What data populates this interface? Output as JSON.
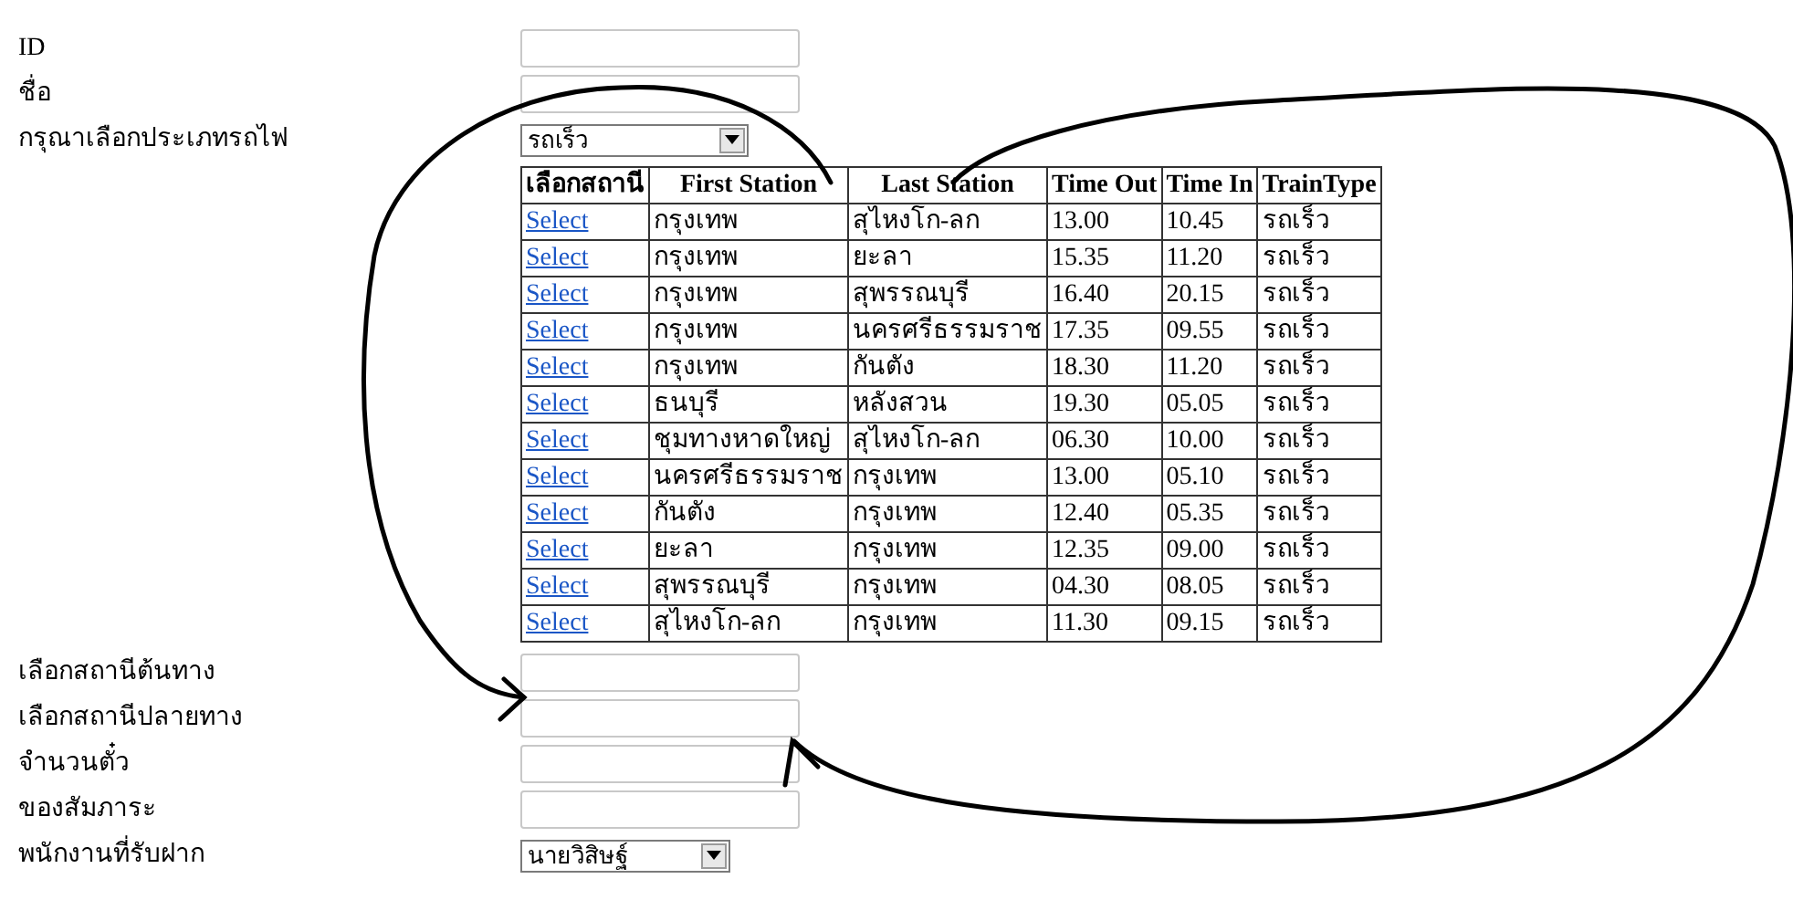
{
  "top_fields": [
    {
      "kind": "text",
      "label": "ID"
    },
    {
      "kind": "text",
      "label": "ชื่อ"
    },
    {
      "kind": "select",
      "label": "กรุณาเลือกประเภทรถไฟ",
      "value": "รถเร็ว"
    }
  ],
  "table": {
    "columns": [
      "เลือกสถานี",
      "First Station",
      "Last Station",
      "Time Out",
      "Time In",
      "TrainType"
    ],
    "rows": [
      [
        "Select",
        "กรุงเทพ",
        "สุไหงโก-ลก",
        "13.00",
        "10.45",
        "รถเร็ว"
      ],
      [
        "Select",
        "กรุงเทพ",
        "ยะลา",
        "15.35",
        "11.20",
        "รถเร็ว"
      ],
      [
        "Select",
        "กรุงเทพ",
        "สุพรรณบุรี",
        "16.40",
        "20.15",
        "รถเร็ว"
      ],
      [
        "Select",
        "กรุงเทพ",
        "นครศรีธรรมราช",
        "17.35",
        "09.55",
        "รถเร็ว"
      ],
      [
        "Select",
        "กรุงเทพ",
        "กันตัง",
        "18.30",
        "11.20",
        "รถเร็ว"
      ],
      [
        "Select",
        "ธนบุรี",
        "หลังสวน",
        "19.30",
        "05.05",
        "รถเร็ว"
      ],
      [
        "Select",
        "ชุมทางหาดใหญ่",
        "สุไหงโก-ลก",
        "06.30",
        "10.00",
        "รถเร็ว"
      ],
      [
        "Select",
        "นครศรีธรรมราช",
        "กรุงเทพ",
        "13.00",
        "05.10",
        "รถเร็ว"
      ],
      [
        "Select",
        "กันตัง",
        "กรุงเทพ",
        "12.40",
        "05.35",
        "รถเร็ว"
      ],
      [
        "Select",
        "ยะลา",
        "กรุงเทพ",
        "12.35",
        "09.00",
        "รถเร็ว"
      ],
      [
        "Select",
        "สุพรรณบุรี",
        "กรุงเทพ",
        "04.30",
        "08.05",
        "รถเร็ว"
      ],
      [
        "Select",
        "สุไหงโก-ลก",
        "กรุงเทพ",
        "11.30",
        "09.15",
        "รถเร็ว"
      ]
    ]
  },
  "bottom_fields": [
    {
      "kind": "text",
      "label": "เลือกสถานีต้นทาง"
    },
    {
      "kind": "text",
      "label": "เลือกสถานีปลายทาง"
    },
    {
      "kind": "text",
      "label": "จำนวนตั๋ว"
    },
    {
      "kind": "text",
      "label": "ของสัมภาระ"
    },
    {
      "kind": "select",
      "label": "พนักงานที่รับฝาก",
      "value": "นายวิสิษฐ์"
    }
  ]
}
